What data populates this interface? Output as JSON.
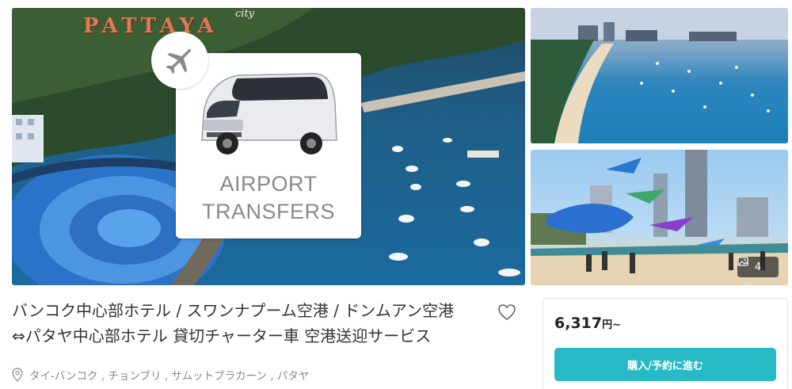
{
  "gallery": {
    "main_sign_text": "PATTAYA",
    "main_sign_city": "city",
    "card_line1": "AIRPORT",
    "card_line2": "TRANSFERS",
    "photo_count": "4"
  },
  "product": {
    "title_line1": "バンコク中心部ホテル / スワンナプーム空港 / ドンムアン空港",
    "title_line2": "⇔パタヤ中心部ホテル 貸切チャーター車 空港送迎サービス",
    "location": "タイ-バンコク , チョンブリ , サムットプラカーン , パタヤ"
  },
  "booking": {
    "price": "6,317",
    "currency_suffix": "円~",
    "button_label": "購入/予約に進む"
  },
  "colors": {
    "accent": "#27bac6",
    "title_text": "#333333",
    "muted_text": "#888888"
  },
  "icons": {
    "badge": "airplane-icon",
    "favorite": "heart-outline-icon",
    "location": "map-pin-icon",
    "gallery": "image-stack-icon"
  }
}
